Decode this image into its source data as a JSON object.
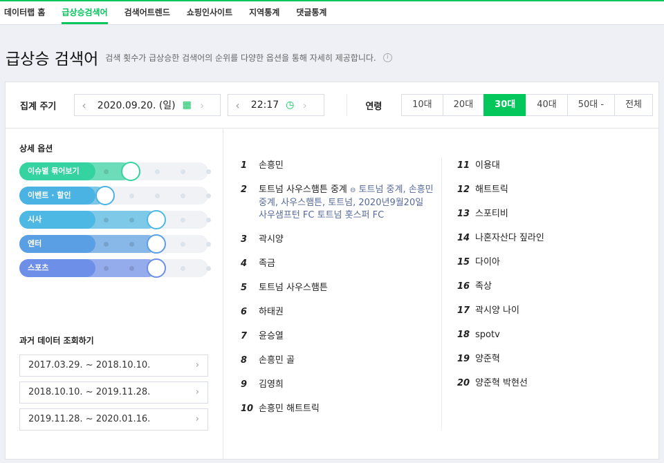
{
  "nav": [
    "데이터랩 홈",
    "급상승검색어",
    "검색어트렌드",
    "쇼핑인사이트",
    "지역통계",
    "댓글통계"
  ],
  "title": "급상승 검색어",
  "subtitle": "검색 횟수가 급상승한 검색어의 순위를 다양한 옵션을 통해 자세히 제공합니다.",
  "info_icon": "i",
  "period": {
    "label": "집계 주기",
    "date": "2020.09.20. (일)",
    "time": "22:17"
  },
  "age": {
    "label": "연령",
    "options": [
      "10대",
      "20대",
      "30대",
      "40대",
      "50대 -",
      "전체"
    ],
    "selected": "30대"
  },
  "options": {
    "title": "상세 옵션",
    "sliders": [
      {
        "name": "이슈별 묶어보기",
        "level": 1,
        "color": "#34d39f"
      },
      {
        "name": "이벤트 · 할인",
        "level": 0,
        "color": "#4ab3e3"
      },
      {
        "name": "시사",
        "level": 2,
        "color": "#4db8e3"
      },
      {
        "name": "엔터",
        "level": 2,
        "color": "#5a9fe3"
      },
      {
        "name": "스포츠",
        "level": 2,
        "color": "#6e8fe8"
      }
    ]
  },
  "past": {
    "title": "과거 데이터 조회하기",
    "ranges": [
      "2017.03.29. ~ 2018.10.10.",
      "2018.10.10. ~ 2019.11.28.",
      "2019.11.28. ~ 2020.01.16."
    ]
  },
  "ranks": [
    {
      "n": "1",
      "kw": "손흥민"
    },
    {
      "n": "2",
      "kw": "토트넘 사우스햄튼 중계",
      "rel": "토트넘 중계, 손흥민 중계, 사우스햄튼, 토트넘, 2020년9월20일 사우샘프턴 FC 토트넘 홋스퍼 FC"
    },
    {
      "n": "3",
      "kw": "곽시양"
    },
    {
      "n": "4",
      "kw": "족금"
    },
    {
      "n": "5",
      "kw": "토트넘 사우스햄튼"
    },
    {
      "n": "6",
      "kw": "하태권"
    },
    {
      "n": "7",
      "kw": "윤승열"
    },
    {
      "n": "8",
      "kw": "손흥민 골"
    },
    {
      "n": "9",
      "kw": "김영희"
    },
    {
      "n": "10",
      "kw": "손흥민 해트트릭"
    },
    {
      "n": "11",
      "kw": "이용대"
    },
    {
      "n": "12",
      "kw": "해트트릭"
    },
    {
      "n": "13",
      "kw": "스포티비"
    },
    {
      "n": "14",
      "kw": "나혼자산다 짚라인"
    },
    {
      "n": "15",
      "kw": "다이아"
    },
    {
      "n": "16",
      "kw": "족상"
    },
    {
      "n": "17",
      "kw": "곽시양 나이"
    },
    {
      "n": "18",
      "kw": "spotv"
    },
    {
      "n": "19",
      "kw": "양준혁"
    },
    {
      "n": "20",
      "kw": "양준혁 박현선"
    }
  ]
}
